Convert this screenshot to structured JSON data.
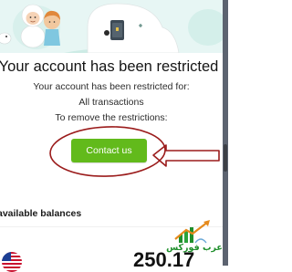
{
  "colors": {
    "hero_background": "#e7f6f4",
    "button_green": "#62ba1b",
    "annotation_red": "#9b1c1c",
    "logo_green": "#1f8f2c"
  },
  "hero": {
    "illustration_icon": "characters-with-door-icon"
  },
  "notice": {
    "title": "Your account has been restricted",
    "line1": "Your account has been restricted for:",
    "line2": "All transactions",
    "line3": "To remove the restrictions:",
    "button_label": "Contact us"
  },
  "balances": {
    "label": "available balances",
    "currency_flag_icon": "us-flag-icon",
    "amount": "250.17"
  },
  "watermark": {
    "text": "عرب فوركس",
    "icon": "chart-arrow-logo-icon"
  }
}
